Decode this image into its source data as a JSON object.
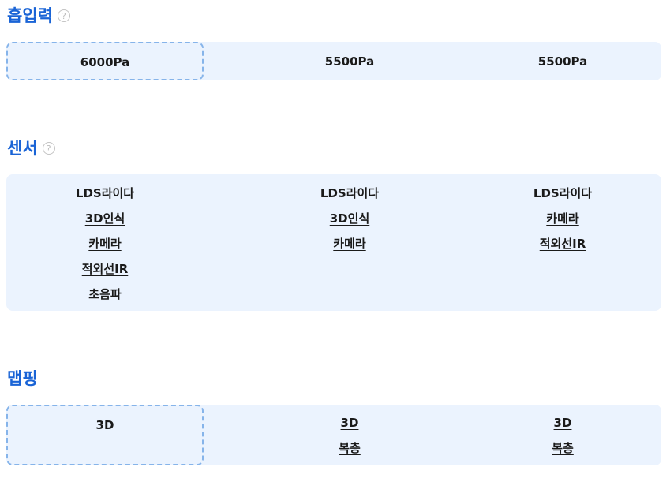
{
  "suction": {
    "title": "흡입력",
    "help": "?",
    "values": [
      "6000Pa",
      "5500Pa",
      "5500Pa"
    ]
  },
  "sensor": {
    "title": "센서",
    "help": "?",
    "columns": [
      [
        "LDS라이다",
        "3D인식",
        "카메라",
        "적외선IR",
        "초음파"
      ],
      [
        "LDS라이다",
        "3D인식",
        "카메라"
      ],
      [
        "LDS라이다",
        "카메라",
        "적외선IR"
      ]
    ]
  },
  "mapping": {
    "title": "맵핑",
    "columns": [
      [
        "3D"
      ],
      [
        "3D",
        "복층"
      ],
      [
        "3D",
        "복층"
      ]
    ]
  },
  "colors": {
    "title": "#1a64d6",
    "panel_bg": "#ebf3fe",
    "selected_border": "#86b4ea"
  }
}
